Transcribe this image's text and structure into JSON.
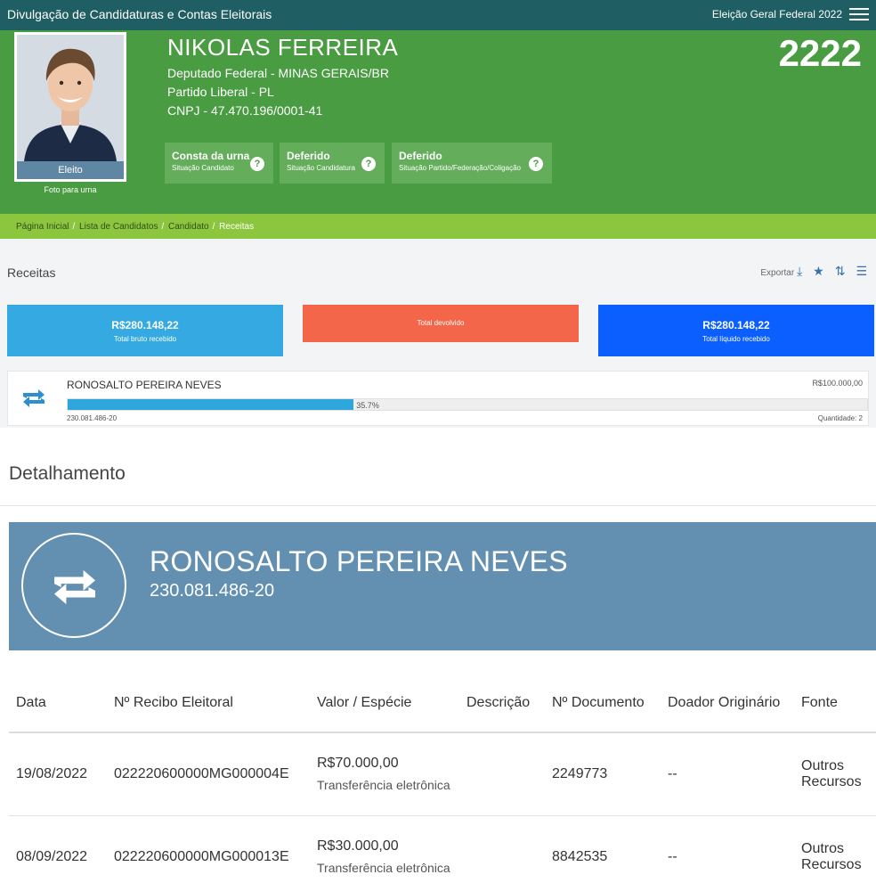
{
  "topbar": {
    "title": "Divulgação de Candidaturas e Contas Eleitorais",
    "election": "Eleição Geral Federal 2022"
  },
  "candidate": {
    "name": "NIKOLAS FERREIRA",
    "office": "Deputado Federal - MINAS GERAIS/BR",
    "party": "Partido Liberal - PL",
    "cnpj": "CNPJ - 47.470.196/0001-41",
    "number": "2222",
    "photo_status": "Eleito",
    "photo_caption": "Foto para urna"
  },
  "statuses": [
    {
      "label": "Consta da urna",
      "sub": "Situação Candidato"
    },
    {
      "label": "Deferido",
      "sub": "Situação Candidatura"
    },
    {
      "label": "Deferido",
      "sub": "Situação Partido/Federação/Coligação"
    }
  ],
  "breadcrumb": [
    "Página Inicial",
    "Lista de Candidatos",
    "Candidato",
    "Receitas"
  ],
  "receitas": {
    "title": "Receitas",
    "export_label": "Exportar",
    "summary": [
      {
        "value": "R$280.148,22",
        "caption": "Total bruto recebido",
        "color": "#35a9e1"
      },
      {
        "value": "",
        "caption": "Total devolvido",
        "color": "#f4664a"
      },
      {
        "value": "R$280.148,22",
        "caption": "Total líquido recebido",
        "color": "#0b5fff"
      }
    ],
    "donor": {
      "name": "RONOSALTO PEREIRA NEVES",
      "amount": "R$100.000,00",
      "percent_label": "35.7%",
      "percent": 35.7,
      "cpf": "230.081.486-20",
      "quantity": "Quantidade: 2"
    }
  },
  "detalhamento": {
    "title": "Detalhamento",
    "name": "RONOSALTO PEREIRA NEVES",
    "cpf": "230.081.486-20",
    "columns": [
      "Data",
      "Nº Recibo Eleitoral",
      "Valor / Espécie",
      "Descrição",
      "Nº Documento",
      "Doador Originário",
      "Fonte"
    ],
    "rows": [
      {
        "data": "19/08/2022",
        "recibo": "022220600000MG000004E",
        "valor": "R$70.000,00",
        "especie": "Transferência eletrônica",
        "descricao": "",
        "documento": "2249773",
        "doador": "--",
        "fonte": "Outros Recursos"
      },
      {
        "data": "08/09/2022",
        "recibo": "022220600000MG000013E",
        "valor": "R$30.000,00",
        "especie": "Transferência eletrônica",
        "descricao": "",
        "documento": "8842535",
        "doador": "--",
        "fonte": "Outros Recursos"
      }
    ]
  }
}
